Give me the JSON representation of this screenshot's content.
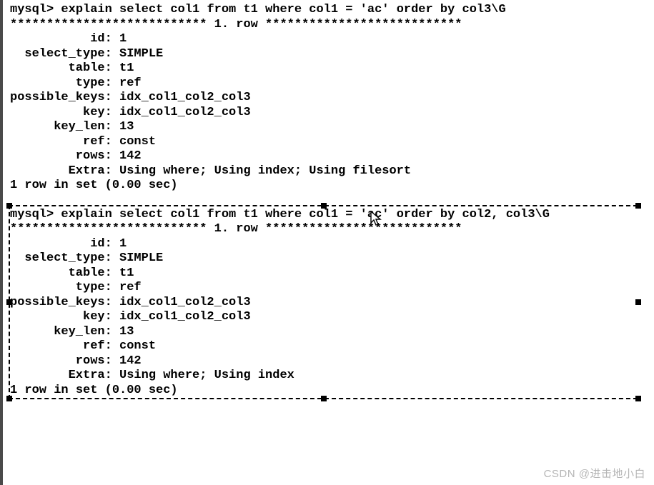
{
  "block1": {
    "prompt": "mysql> explain select col1 from t1 where col1 = 'ac' order by col3\\G",
    "row_marker": "*************************** 1. row ***************************",
    "rows": [
      {
        "k": "id",
        "v": "1"
      },
      {
        "k": "select_type",
        "v": "SIMPLE"
      },
      {
        "k": "table",
        "v": "t1"
      },
      {
        "k": "type",
        "v": "ref"
      },
      {
        "k": "possible_keys",
        "v": "idx_col1_col2_col3"
      },
      {
        "k": "key",
        "v": "idx_col1_col2_col3"
      },
      {
        "k": "key_len",
        "v": "13"
      },
      {
        "k": "ref",
        "v": "const"
      },
      {
        "k": "rows",
        "v": "142"
      },
      {
        "k": "Extra",
        "v": "Using where; Using index; Using filesort"
      }
    ],
    "footer": "1 row in set (0.00 sec)"
  },
  "block2": {
    "prompt": "mysql> explain select col1 from t1 where col1 = 'ac' order by col2, col3\\G",
    "row_marker": "*************************** 1. row ***************************",
    "rows": [
      {
        "k": "id",
        "v": "1"
      },
      {
        "k": "select_type",
        "v": "SIMPLE"
      },
      {
        "k": "table",
        "v": "t1"
      },
      {
        "k": "type",
        "v": "ref"
      },
      {
        "k": "possible_keys",
        "v": "idx_col1_col2_col3"
      },
      {
        "k": "key",
        "v": "idx_col1_col2_col3"
      },
      {
        "k": "key_len",
        "v": "13"
      },
      {
        "k": "ref",
        "v": "const"
      },
      {
        "k": "rows",
        "v": "142"
      },
      {
        "k": "Extra",
        "v": "Using where; Using index"
      }
    ],
    "footer": "1 row in set (0.00 sec)"
  },
  "watermark": "CSDN @进击地小白"
}
